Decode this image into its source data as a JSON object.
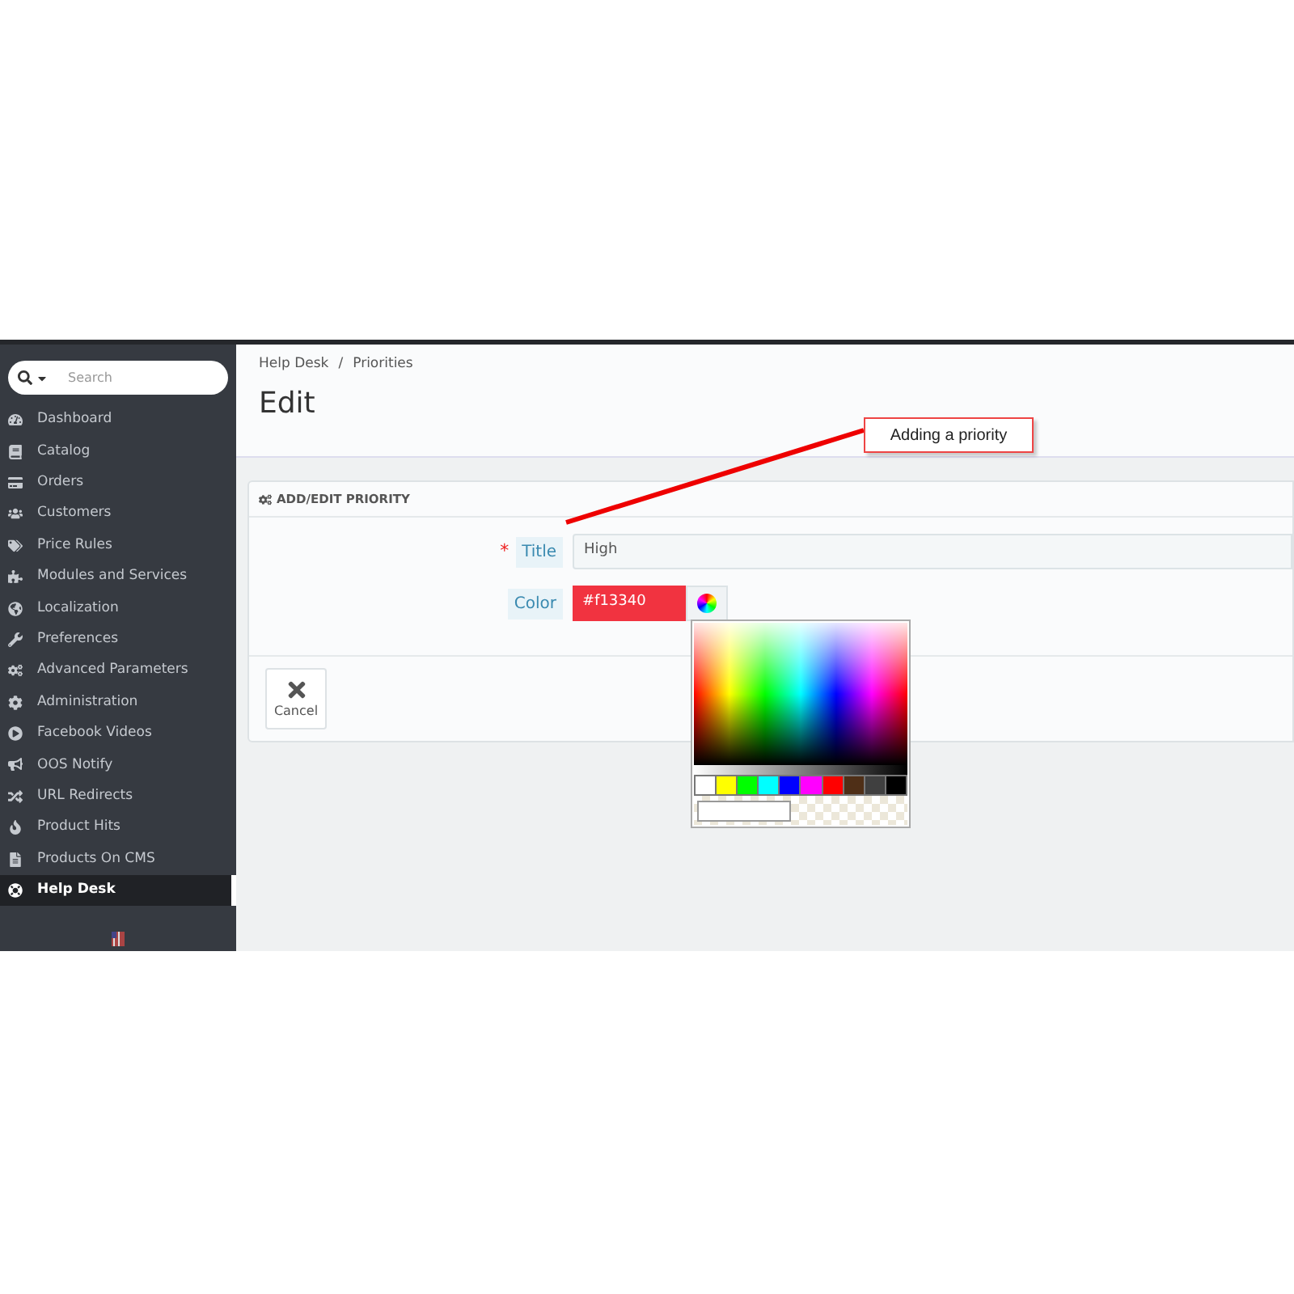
{
  "sidebar": {
    "search": {
      "placeholder": "Search"
    },
    "items": [
      {
        "label": "Dashboard",
        "selected": false
      },
      {
        "label": "Catalog",
        "selected": false
      },
      {
        "label": "Orders",
        "selected": false
      },
      {
        "label": "Customers",
        "selected": false
      },
      {
        "label": "Price Rules",
        "selected": false
      },
      {
        "label": "Modules and Services",
        "selected": false
      },
      {
        "label": "Localization",
        "selected": false
      },
      {
        "label": "Preferences",
        "selected": false
      },
      {
        "label": "Advanced Parameters",
        "selected": false
      },
      {
        "label": "Administration",
        "selected": false
      },
      {
        "label": "Facebook Videos",
        "selected": false
      },
      {
        "label": "OOS Notify",
        "selected": false
      },
      {
        "label": "URL Redirects",
        "selected": false
      },
      {
        "label": "Product Hits",
        "selected": false
      },
      {
        "label": "Products On CMS",
        "selected": false
      },
      {
        "label": "Help Desk",
        "selected": true
      }
    ]
  },
  "breadcrumb": [
    "Help Desk",
    "/",
    "Priorities"
  ],
  "page_title": "Edit",
  "annotation": "Adding a priority",
  "panel": {
    "title": "ADD/EDIT PRIORITY",
    "fields": [
      {
        "kind": "text",
        "label": "Title",
        "required_mark": "*",
        "value": "High"
      },
      {
        "kind": "color",
        "label": "Color",
        "value": "#f13340",
        "color": "#f13340"
      }
    ],
    "cancel": "Cancel"
  },
  "color_picker": {
    "swatches": [
      {
        "color": "#ffffff"
      },
      {
        "color": "#ffff00"
      },
      {
        "color": "#00ff00"
      },
      {
        "color": "#00ffff"
      },
      {
        "color": "#0000ff"
      },
      {
        "color": "#ff00ff"
      },
      {
        "color": "#ff0000"
      },
      {
        "color": "#4f2f17"
      },
      {
        "color": "#404040"
      },
      {
        "color": "#000000"
      }
    ]
  }
}
